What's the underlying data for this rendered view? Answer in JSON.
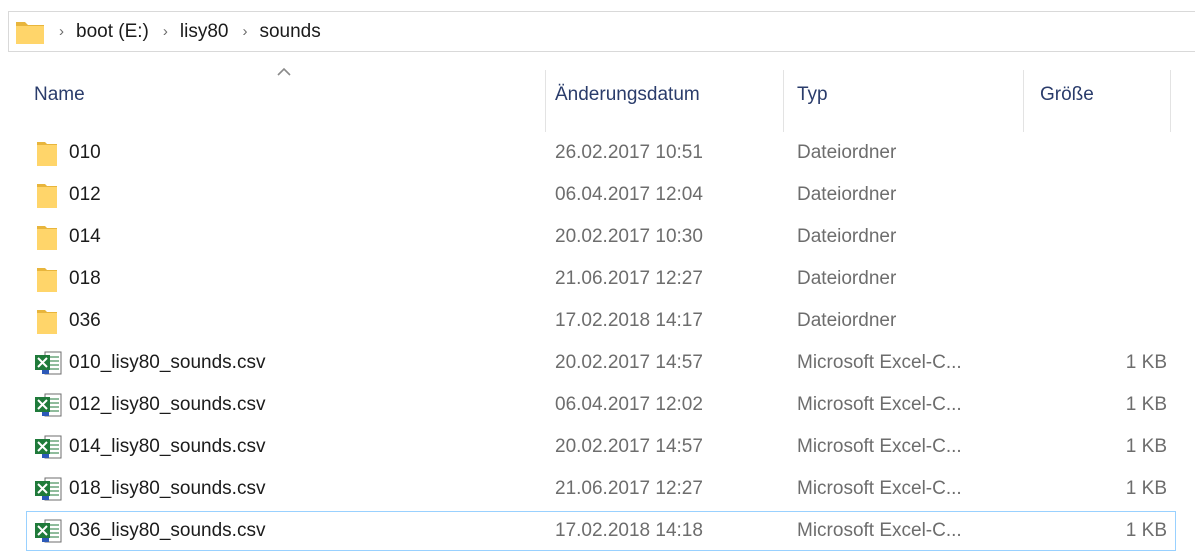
{
  "breadcrumb": {
    "items": [
      "boot (E:)",
      "lisy80",
      "sounds"
    ],
    "separator": "›"
  },
  "columns": {
    "name": "Name",
    "date": "Änderungsdatum",
    "type": "Typ",
    "size": "Größe",
    "sorted_by": "name",
    "sort_direction": "ascending"
  },
  "files": [
    {
      "name": "010",
      "date": "26.02.2017 10:51",
      "type": "Dateiordner",
      "size": "",
      "icon": "folder-icon"
    },
    {
      "name": "012",
      "date": "06.04.2017 12:04",
      "type": "Dateiordner",
      "size": "",
      "icon": "folder-icon"
    },
    {
      "name": "014",
      "date": "20.02.2017 10:30",
      "type": "Dateiordner",
      "size": "",
      "icon": "folder-icon"
    },
    {
      "name": "018",
      "date": "21.06.2017 12:27",
      "type": "Dateiordner",
      "size": "",
      "icon": "folder-icon"
    },
    {
      "name": "036",
      "date": "17.02.2018 14:17",
      "type": "Dateiordner",
      "size": "",
      "icon": "folder-icon"
    },
    {
      "name": "010_lisy80_sounds.csv",
      "date": "20.02.2017 14:57",
      "type": "Microsoft Excel-C...",
      "size": "1 KB",
      "icon": "excel-csv-icon"
    },
    {
      "name": "012_lisy80_sounds.csv",
      "date": "06.04.2017 12:02",
      "type": "Microsoft Excel-C...",
      "size": "1 KB",
      "icon": "excel-csv-icon"
    },
    {
      "name": "014_lisy80_sounds.csv",
      "date": "20.02.2017 14:57",
      "type": "Microsoft Excel-C...",
      "size": "1 KB",
      "icon": "excel-csv-icon"
    },
    {
      "name": "018_lisy80_sounds.csv",
      "date": "21.06.2017 12:27",
      "type": "Microsoft Excel-C...",
      "size": "1 KB",
      "icon": "excel-csv-icon"
    },
    {
      "name": "036_lisy80_sounds.csv",
      "date": "17.02.2018 14:18",
      "type": "Microsoft Excel-C...",
      "size": "1 KB",
      "icon": "excel-csv-icon"
    }
  ],
  "focused_index": 9,
  "colors": {
    "folder": "#ffd56a",
    "folder_dark": "#e8b53c",
    "excel_green": "#1f7a3a",
    "header_text": "#2a3c6b",
    "focus_border": "#99d1ff"
  }
}
